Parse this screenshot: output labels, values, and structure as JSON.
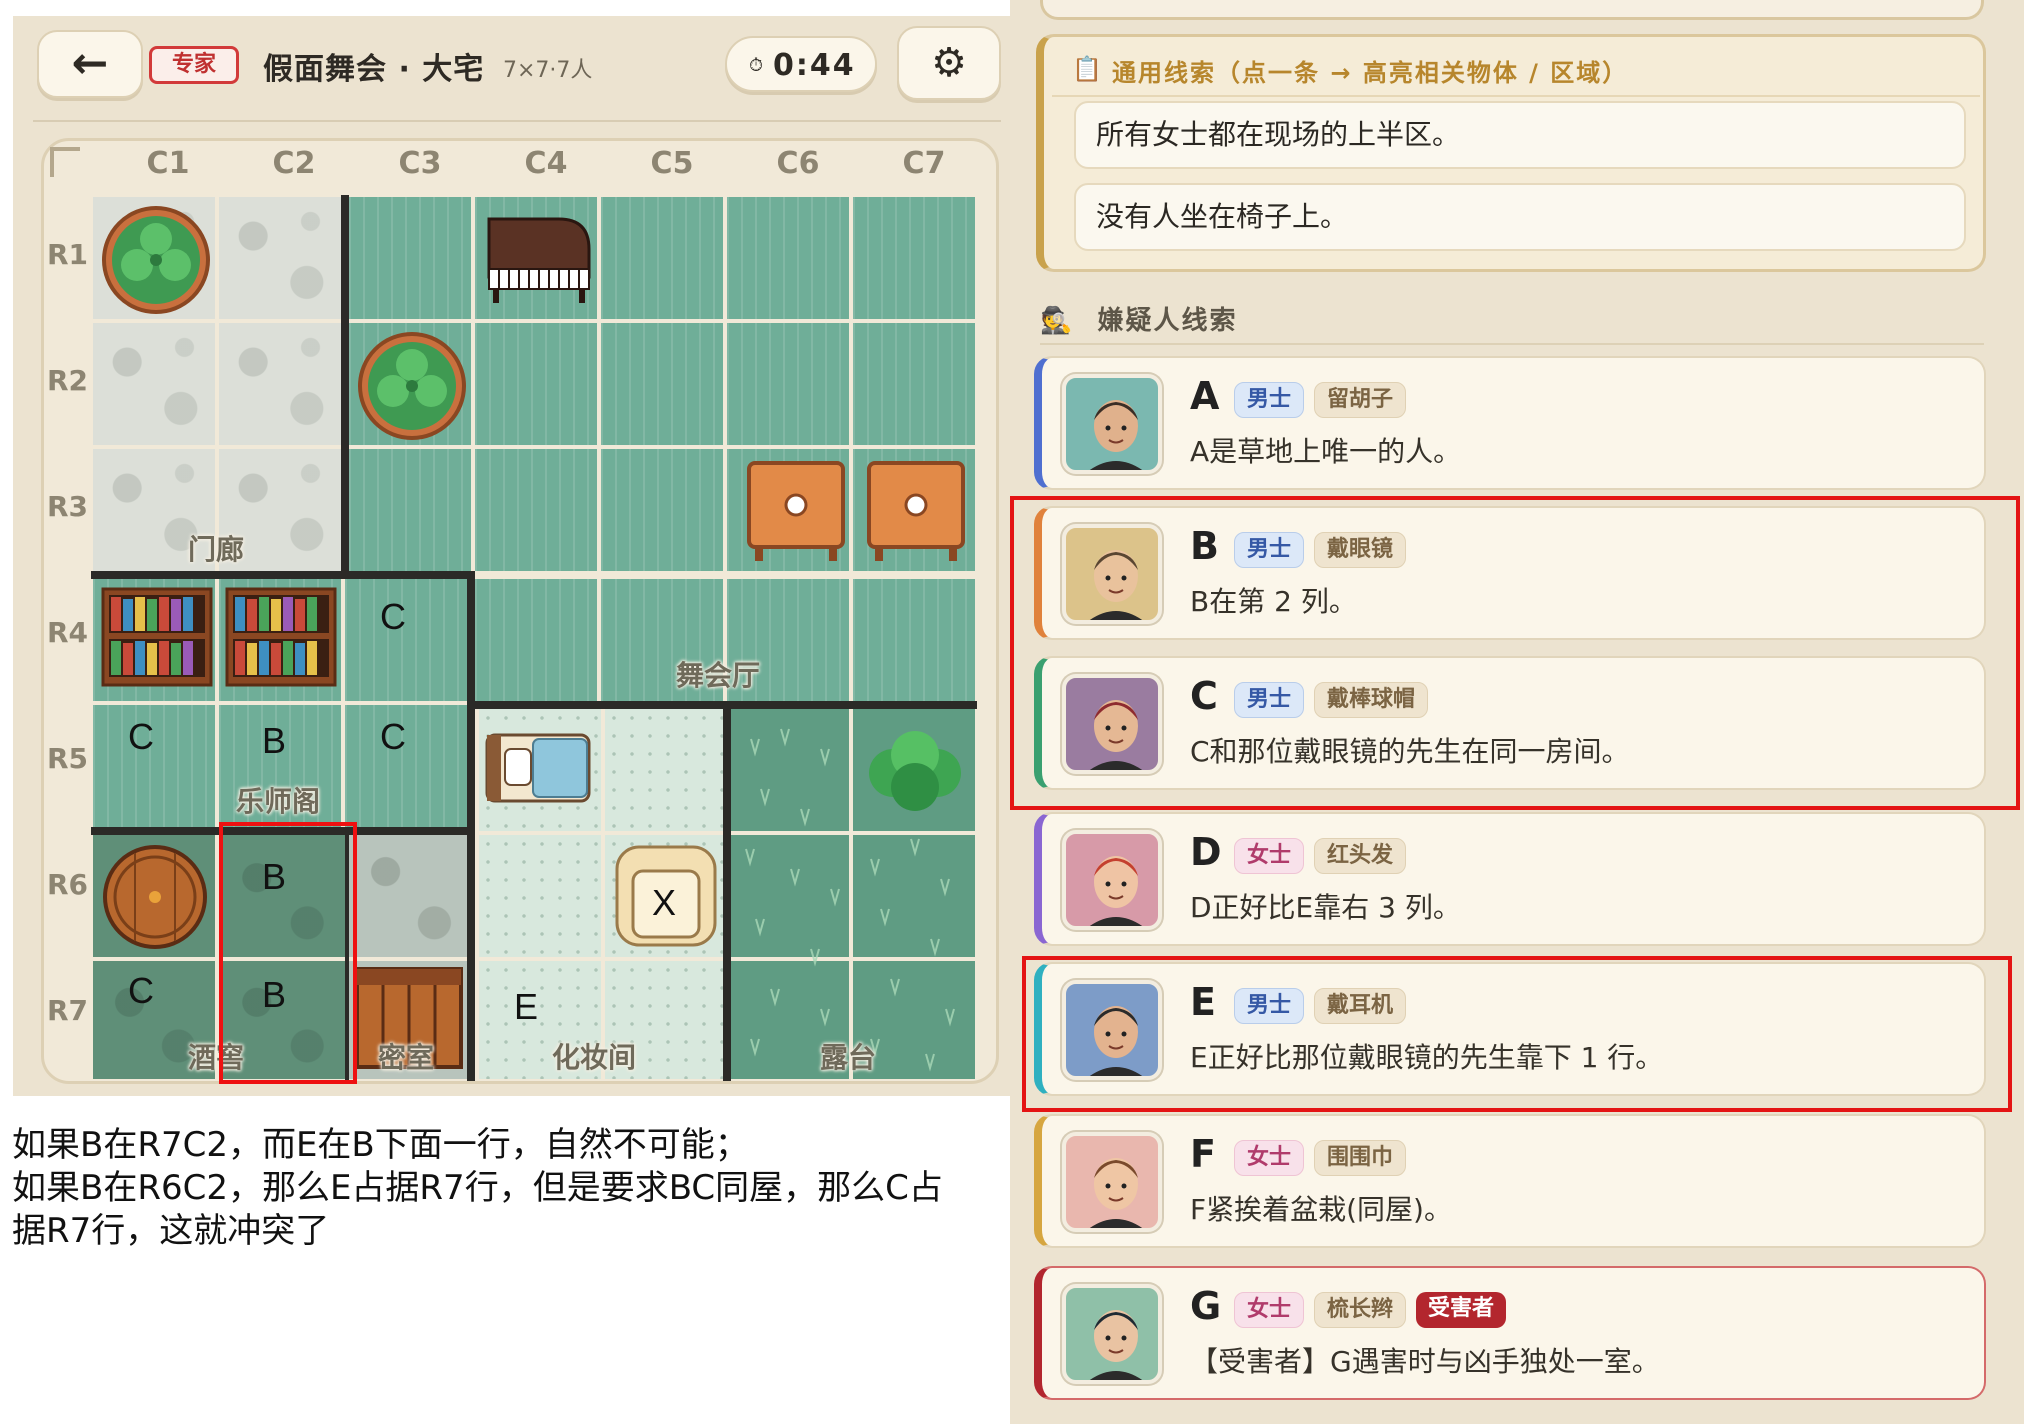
{
  "header": {
    "back_icon": "←",
    "level": "专家",
    "title": "假面舞会 · 大宅",
    "meta": "7×7·7人",
    "timer_icon": "⏱",
    "timer": "0:44",
    "settings_icon": "⚙"
  },
  "board": {
    "columns": [
      "C1",
      "C2",
      "C3",
      "C4",
      "C5",
      "C6",
      "C7"
    ],
    "rows": [
      "R1",
      "R2",
      "R3",
      "R4",
      "R5",
      "R6",
      "R7"
    ],
    "rooms": {
      "foyer": "门廊",
      "ballroom": "舞会厅",
      "music_loft": "乐师阁",
      "cellar": "酒窖",
      "secret_room": "密室",
      "dressing_room": "化妆间",
      "terrace": "露台"
    },
    "marks": {
      "r4c3": "C",
      "r5c1": "C",
      "r5c2": "B",
      "r5c3": "C",
      "r6c2": "B",
      "r7c1": "C",
      "r7c2": "B",
      "r7c4": "E",
      "r6c5": "X"
    }
  },
  "note": {
    "line1": "如果B在R7C2，而E在B下面一行，自然不可能；",
    "line2": "如果B在R6C2，那么E占据R7行，但是要求BC同屋，那么C占",
    "line3": "据R7行，这就冲突了"
  },
  "general_clues": {
    "icon": "📋",
    "header": "通用线索（点一条 → 高亮相关物体 / 区域）",
    "items": [
      "所有女士都在现场的上半区。",
      "没有人坐在椅子上。"
    ]
  },
  "suspects": {
    "icon": "🕵",
    "header": "嫌疑人线索",
    "items": [
      {
        "letter": "A",
        "gender": "男士",
        "trait": "留胡子",
        "clue": "A是草地上唯一的人。",
        "accent": "#4f6fd0",
        "skin": "#e0b18c",
        "hair": "#3a2e26",
        "bg": "#7bb8b0"
      },
      {
        "letter": "B",
        "gender": "男士",
        "trait": "戴眼镜",
        "clue": "B在第 2 列。",
        "accent": "#e0823c",
        "skin": "#e9c29c",
        "hair": "#5a4632",
        "bg": "#dcc38a"
      },
      {
        "letter": "C",
        "gender": "男士",
        "trait": "戴棒球帽",
        "clue": "C和那位戴眼镜的先生在同一房间。",
        "accent": "#3aa070",
        "skin": "#e5b894",
        "hair": "#8e2b30",
        "bg": "#9a7ca0"
      },
      {
        "letter": "D",
        "gender": "女士",
        "trait": "红头发",
        "clue": "D正好比E靠右 3 列。",
        "accent": "#8a66d2",
        "skin": "#efc4a4",
        "hair": "#c4402f",
        "bg": "#d79aa8"
      },
      {
        "letter": "E",
        "gender": "男士",
        "trait": "戴耳机",
        "clue": "E正好比那位戴眼镜的先生靠下 1 行。",
        "accent": "#2fb0c0",
        "skin": "#e3b38f",
        "hair": "#2b2b2b",
        "bg": "#7d9cc8"
      },
      {
        "letter": "F",
        "gender": "女士",
        "trait": "围围巾",
        "clue": "F紧挨着盆栽(同屋)。",
        "accent": "#d6a640",
        "skin": "#efc6a4",
        "hair": "#7a4a2c",
        "bg": "#e9b7ae"
      },
      {
        "letter": "G",
        "gender": "女士",
        "trait": "梳长辫",
        "clue": "【受害者】G遇害时与凶手独处一室。",
        "accent": "#b2262e",
        "skin": "#e9c3a2",
        "hair": "#1f2a33",
        "bg": "#8fc0a8",
        "victim": "受害者"
      }
    ]
  }
}
